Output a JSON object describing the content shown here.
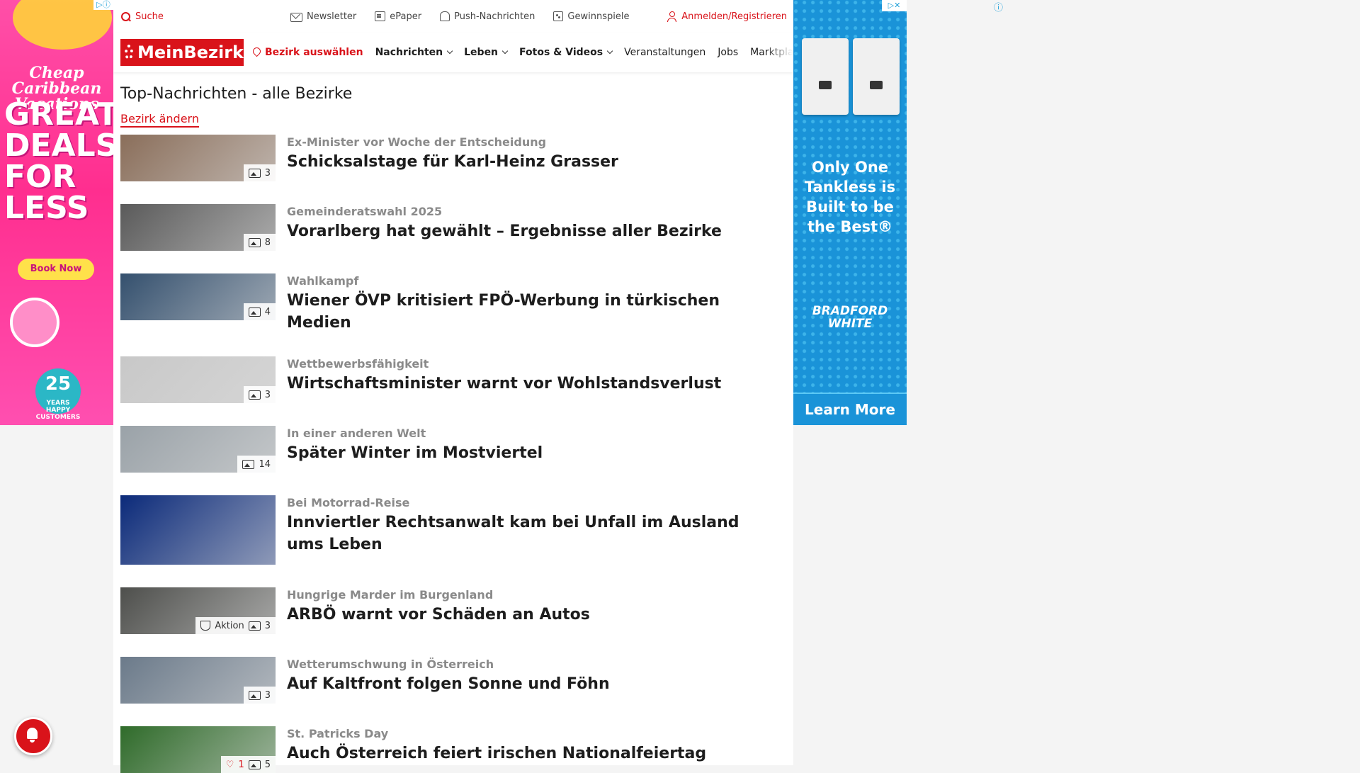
{
  "util_bar": {
    "search": "Suche",
    "newsletter": "Newsletter",
    "epaper": "ePaper",
    "push": "Push-Nachrichten",
    "gewinnspiele": "Gewinnspiele",
    "login": "Anmelden/Registrieren"
  },
  "nav": {
    "logo": "MeinBezirk",
    "bezirk": "Bezirk auswählen",
    "items": [
      "Nachrichten",
      "Leben",
      "Fotos & Videos",
      "Veranstaltungen",
      "Jobs",
      "Marktplatz"
    ]
  },
  "page": {
    "title": "Top-Nachrichten - alle Bezirke",
    "change_link": "Bezirk ändern"
  },
  "articles": [
    {
      "kicker": "Ex-Minister vor Woche der Entscheidung",
      "headline": "Schicksalstage für Karl-Heinz Grasser",
      "images": "3",
      "thumb_color": "#8a6e5a"
    },
    {
      "kicker": "Gemeinderatswahl 2025",
      "headline": "Vorarlberg hat gewählt – Ergebnisse aller Bezirke",
      "images": "8",
      "thumb_color": "#5a5a5a"
    },
    {
      "kicker": "Wahlkampf",
      "headline": "Wiener ÖVP kritisiert FPÖ-Werbung in türkischen Medien",
      "images": "4",
      "thumb_color": "#34506e"
    },
    {
      "kicker": "Wettbewerbsfähigkeit",
      "headline": "Wirtschaftsminister warnt vor Wohlstandsverlust",
      "images": "3",
      "thumb_color": "#c8c8c8"
    },
    {
      "kicker": "In einer anderen Welt",
      "headline": "Später Winter im Mostviertel",
      "images": "14",
      "thumb_color": "#9aa2a8"
    },
    {
      "kicker": "Bei Motorrad-Reise",
      "headline": "Innviertler Rechtsanwalt kam bei Unfall im Ausland ums Leben",
      "images": "",
      "thumb_color": "#0b2a7a"
    },
    {
      "kicker": "Hungrige Marder im Burgenland",
      "headline": "ARBÖ warnt vor Schäden an Autos",
      "images": "3",
      "aktion": "Aktion",
      "thumb_color": "#4e4f4c"
    },
    {
      "kicker": "Wetterumschwung in Österreich",
      "headline": "Auf Kaltfront folgen Sonne und Föhn",
      "images": "3",
      "thumb_color": "#6b7a8a"
    },
    {
      "kicker": "St. Patricks Day",
      "headline": "Auch Österreich feiert irischen Nationalfeiertag",
      "images": "5",
      "likes": "1",
      "thumb_color": "#2f6b2a"
    }
  ],
  "ad_left": {
    "brand": "Cheap Caribbean Vacations",
    "headline": "GREAT DEALS FOR LESS",
    "cta": "Book Now",
    "badge_num": "25",
    "badge_text": "YEARS HAPPY CUSTOMERS"
  },
  "ad_right": {
    "slogan": "Only One Tankless is Built to be the Best®",
    "brand": "BRADFORD WHITE",
    "cta": "Learn More"
  }
}
